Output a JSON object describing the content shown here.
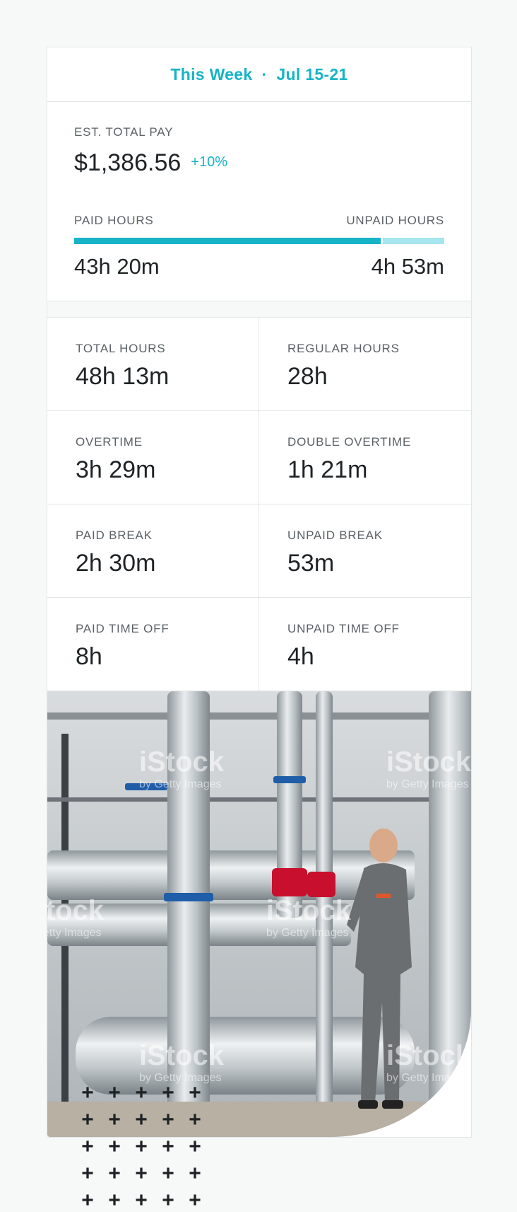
{
  "header": {
    "period_label": "This Week",
    "separator": "·",
    "date_range": "Jul 15-21",
    "accent_color": "#17b3c7"
  },
  "pay": {
    "caption": "EST. TOTAL PAY",
    "amount": "$1,386.56",
    "change": "+10%"
  },
  "hours_bar": {
    "paid_label": "PAID HOURS",
    "unpaid_label": "UNPAID HOURS",
    "paid_value": "43h 20m",
    "unpaid_value": "4h 53m",
    "paid_fraction": 0.829,
    "paid_color": "#17b3c7",
    "unpaid_color": "#a6e6ee"
  },
  "stats": [
    {
      "label": "TOTAL HOURS",
      "value": "48h 13m"
    },
    {
      "label": "REGULAR HOURS",
      "value": "28h"
    },
    {
      "label": "OVERTIME",
      "value": "3h 29m"
    },
    {
      "label": "DOUBLE OVERTIME",
      "value": "1h 21m"
    },
    {
      "label": "PAID BREAK",
      "value": "2h 30m"
    },
    {
      "label": "UNPAID BREAK",
      "value": "53m"
    },
    {
      "label": "PAID TIME OFF",
      "value": "8h"
    },
    {
      "label": "UNPAID TIME OFF",
      "value": "4h"
    }
  ],
  "photo": {
    "subject": "worker inspecting industrial pipes",
    "watermark_brand": "iStock",
    "watermark_sub": "by Getty Images"
  },
  "decor": {
    "plus_glyph": "+",
    "plus_count": 25
  }
}
